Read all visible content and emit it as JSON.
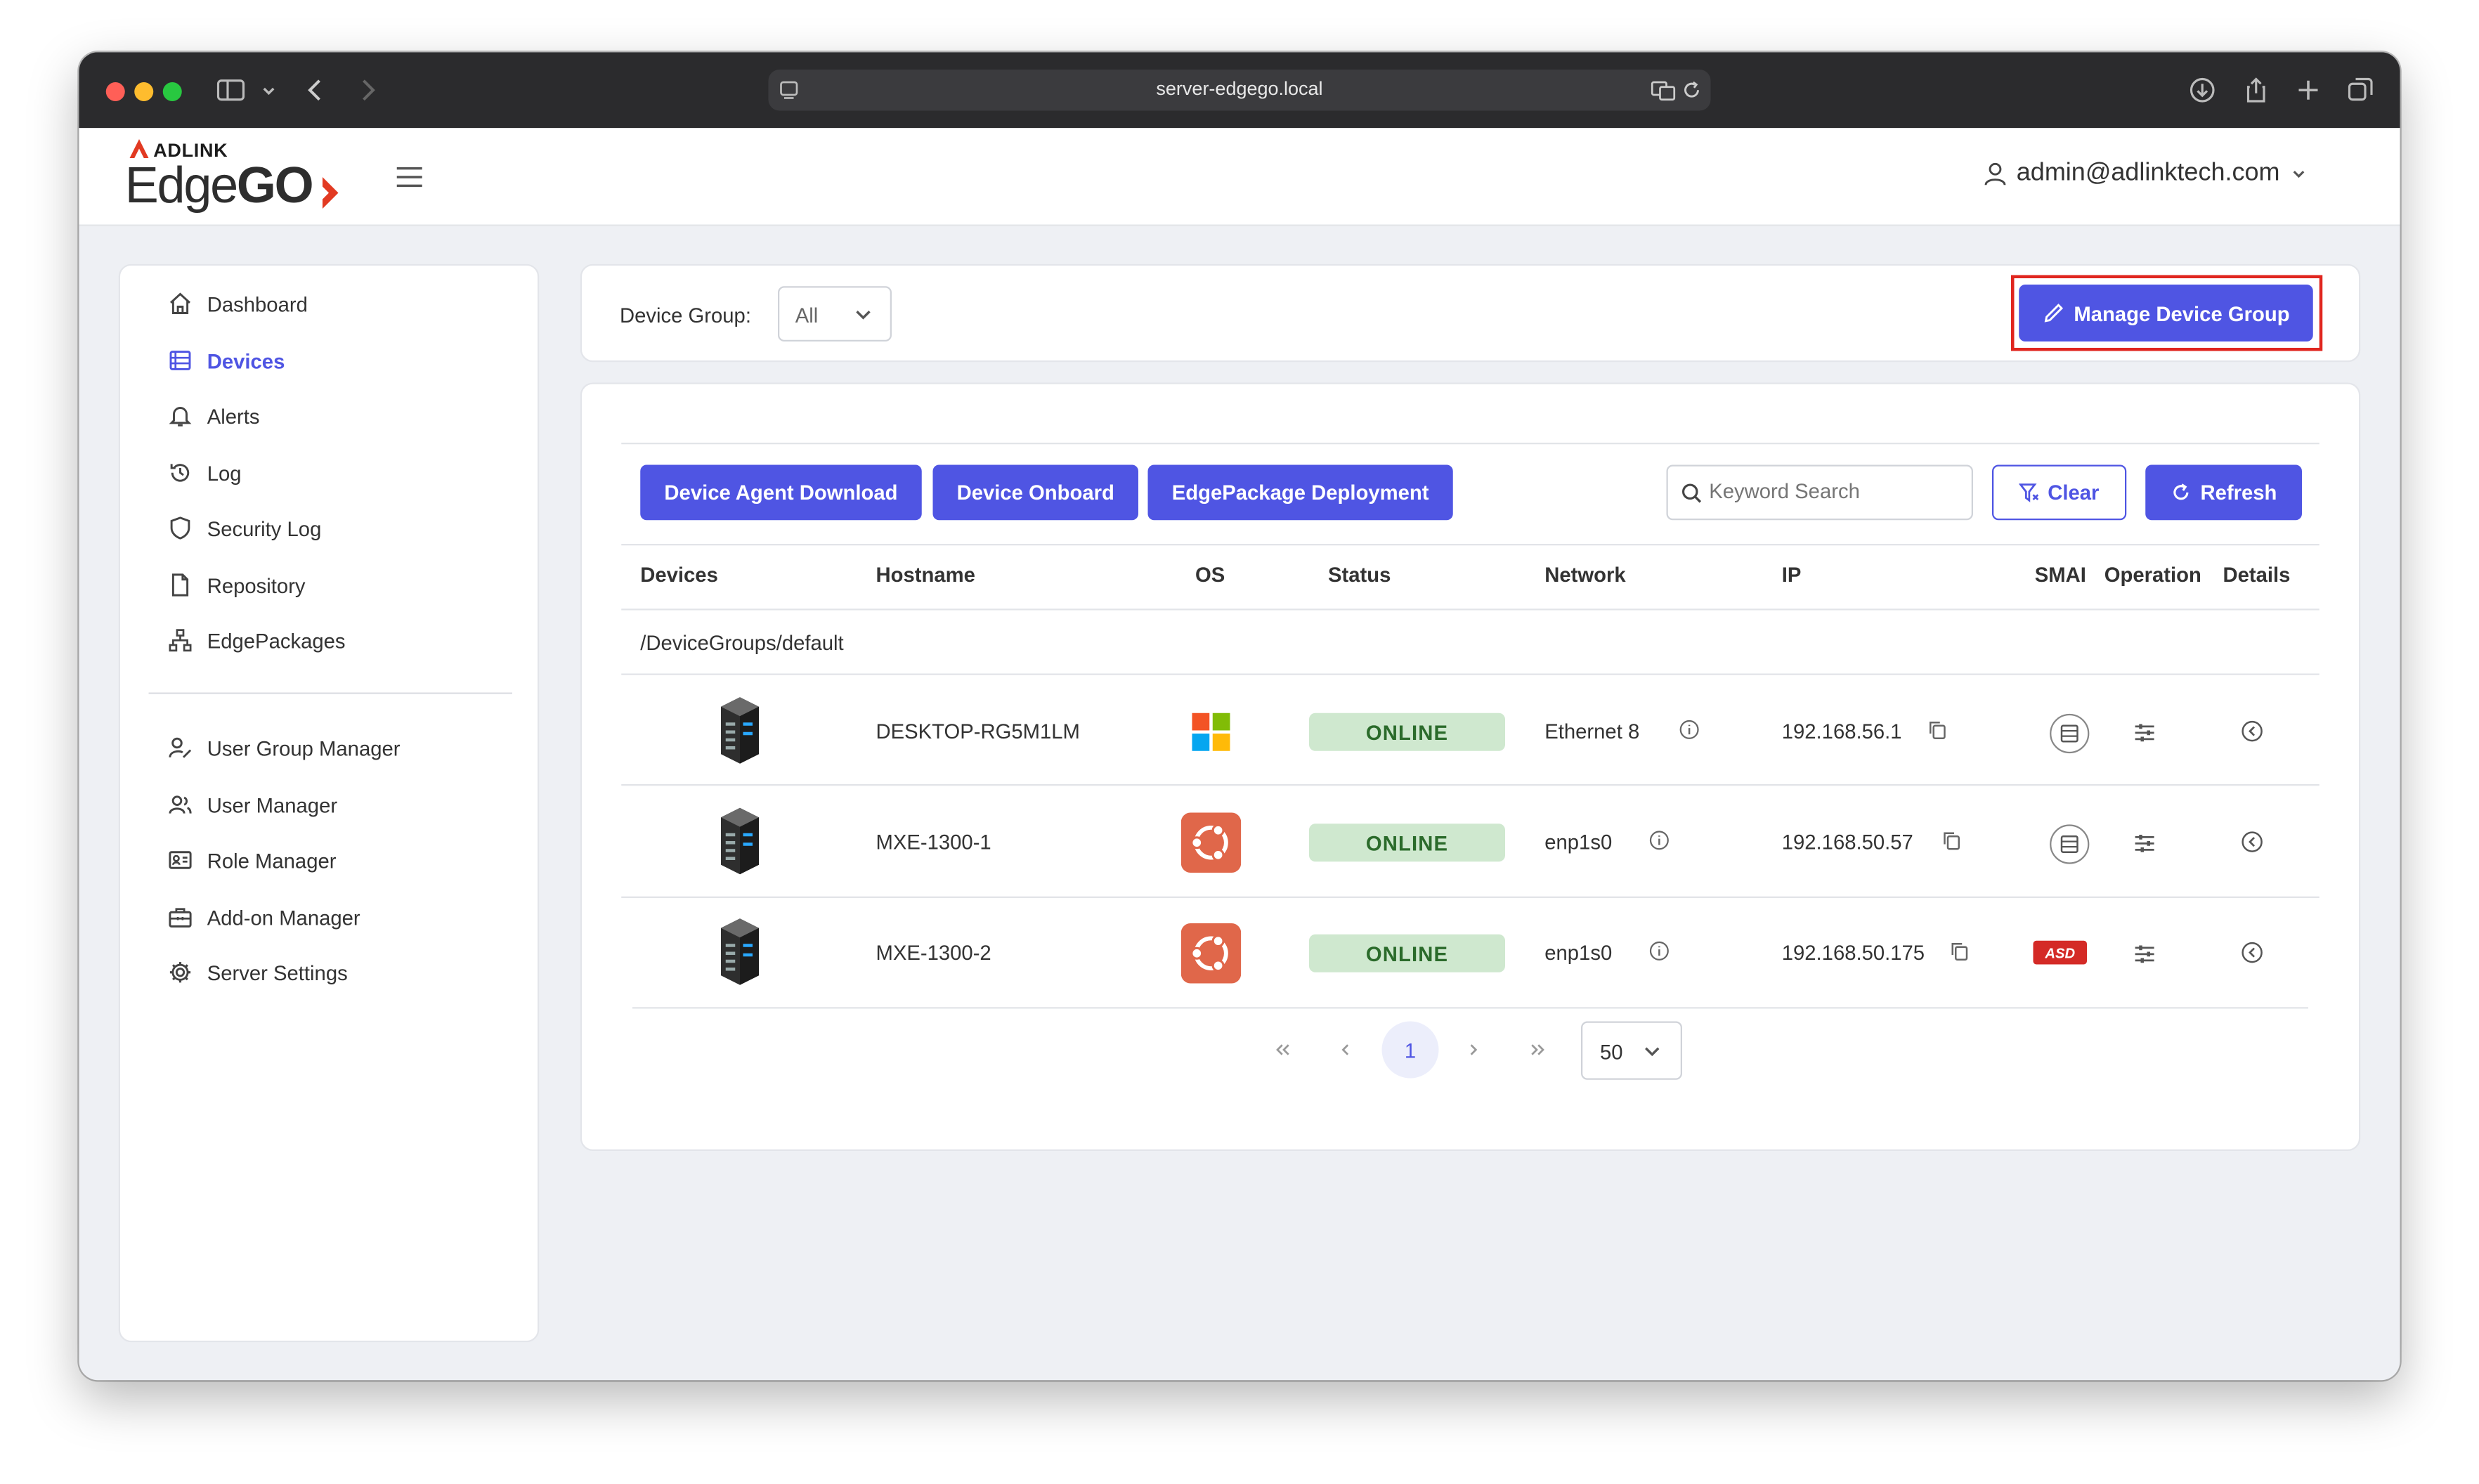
{
  "browser": {
    "url": "server-edgego.local"
  },
  "brand": {
    "top": "ADLINK",
    "name_a": "Edge",
    "name_b": "GO",
    "accent": "#e23a22"
  },
  "header": {
    "user": "admin@adlinktech.com"
  },
  "sidebar": {
    "items": [
      {
        "label": "Dashboard",
        "icon": "home-icon"
      },
      {
        "label": "Devices",
        "icon": "list-icon",
        "active": true
      },
      {
        "label": "Alerts",
        "icon": "bell-icon"
      },
      {
        "label": "Log",
        "icon": "history-icon"
      },
      {
        "label": "Security Log",
        "icon": "shield-icon"
      },
      {
        "label": "Repository",
        "icon": "file-icon"
      },
      {
        "label": "EdgePackages",
        "icon": "sitemap-icon"
      }
    ],
    "admin_items": [
      {
        "label": "User Group Manager",
        "icon": "user-edit-icon"
      },
      {
        "label": "User Manager",
        "icon": "users-icon"
      },
      {
        "label": "Role Manager",
        "icon": "id-card-icon"
      },
      {
        "label": "Add-on Manager",
        "icon": "toolbox-icon"
      },
      {
        "label": "Server Settings",
        "icon": "gear-icon"
      }
    ]
  },
  "filter": {
    "label": "Device Group:",
    "value": "All",
    "manage_button": "Manage Device Group"
  },
  "toolbar": {
    "agent_download": "Device Agent Download",
    "onboard": "Device Onboard",
    "deployment": "EdgePackage Deployment",
    "search_placeholder": "Keyword Search",
    "clear": "Clear",
    "refresh": "Refresh"
  },
  "table": {
    "columns": [
      "Devices",
      "Hostname",
      "OS",
      "Status",
      "Network",
      "IP",
      "SMAI",
      "Operation",
      "Details"
    ],
    "group": "/DeviceGroups/default",
    "rows": [
      {
        "hostname": "DESKTOP-RG5M1LM",
        "os": "windows",
        "status": "ONLINE",
        "network": "Ethernet 8",
        "ip": "192.168.56.1",
        "smai": "list-circle"
      },
      {
        "hostname": "MXE-1300-1",
        "os": "ubuntu",
        "status": "ONLINE",
        "network": "enp1s0",
        "ip": "192.168.50.57",
        "smai": "list-circle"
      },
      {
        "hostname": "MXE-1300-2",
        "os": "ubuntu",
        "status": "ONLINE",
        "network": "enp1s0",
        "ip": "192.168.50.175",
        "smai": "asd-logo"
      }
    ]
  },
  "smai_logo_text": "ASD",
  "pagination": {
    "current": "1",
    "page_size": "50"
  },
  "colors": {
    "primary": "#4f55e3",
    "online_bg": "#cfe8cf",
    "online_text": "#2b6b2b",
    "highlight": "#e0261f"
  }
}
